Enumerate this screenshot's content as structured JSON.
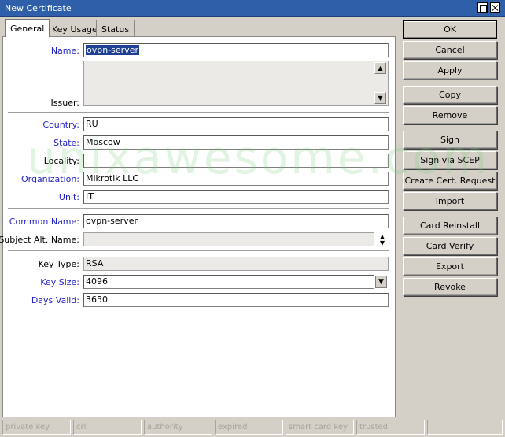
{
  "window": {
    "title": "New Certificate"
  },
  "tabs": [
    {
      "label": "General"
    },
    {
      "label": "Key Usage"
    },
    {
      "label": "Status"
    }
  ],
  "form": {
    "name": {
      "label": "Name:",
      "value": "ovpn-server"
    },
    "issuer": {
      "label": "Issuer:",
      "value": ""
    },
    "country": {
      "label": "Country:",
      "value": "RU"
    },
    "state": {
      "label": "State:",
      "value": "Moscow"
    },
    "locality": {
      "label": "Locality:",
      "value": ""
    },
    "organization": {
      "label": "Organization:",
      "value": "Mikrotik LLC"
    },
    "unit": {
      "label": "Unit:",
      "value": "IT"
    },
    "common_name": {
      "label": "Common Name:",
      "value": "ovpn-server"
    },
    "subject_alt_name": {
      "label": "Subject Alt. Name:",
      "value": ""
    },
    "key_type": {
      "label": "Key Type:",
      "value": "RSA"
    },
    "key_size": {
      "label": "Key Size:",
      "value": "4096"
    },
    "days_valid": {
      "label": "Days Valid:",
      "value": "3650"
    }
  },
  "buttons": {
    "ok": "OK",
    "cancel": "Cancel",
    "apply": "Apply",
    "copy": "Copy",
    "remove": "Remove",
    "sign": "Sign",
    "sign_scep": "Sign via SCEP",
    "create_request": "Create Cert. Request",
    "import": "Import",
    "card_reinstall": "Card Reinstall",
    "card_verify": "Card Verify",
    "export": "Export",
    "revoke": "Revoke"
  },
  "watermark": "unixawesome.com",
  "status_bar": [
    "private key",
    "crl",
    "authority",
    "expired",
    "smart card key",
    "trusted",
    ""
  ],
  "colors": {
    "title_bar": "#2f5fa8",
    "label_accent": "#2323c8",
    "selection": "#1f3f92"
  }
}
